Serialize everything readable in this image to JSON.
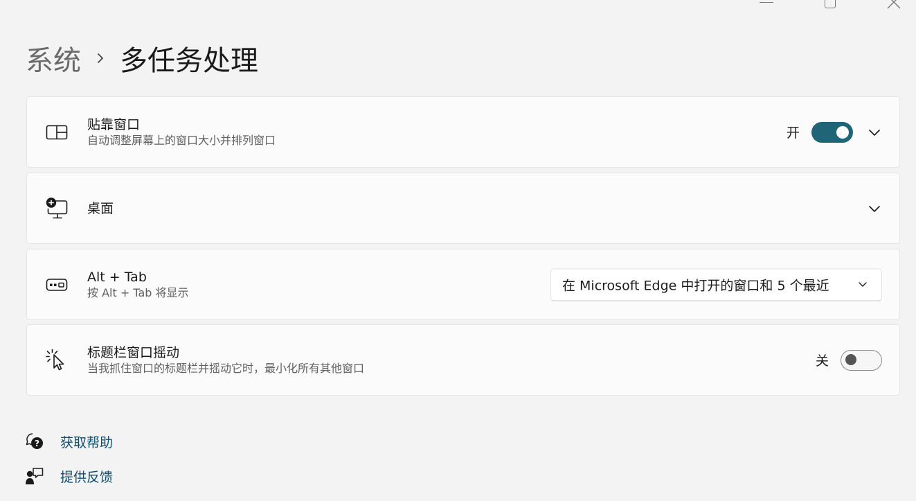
{
  "breadcrumb": {
    "parent": "系统",
    "current": "多任务处理"
  },
  "snap_windows": {
    "title": "贴靠窗口",
    "subtitle": "自动调整屏幕上的窗口大小并排列窗口",
    "toggle_label": "开",
    "toggle_on": true,
    "icon": "snap-layout-icon"
  },
  "desktops": {
    "title": "桌面",
    "icon": "desktop-add-icon"
  },
  "alt_tab": {
    "title": "Alt + Tab",
    "subtitle": "按 Alt + Tab 将显示",
    "dropdown_value": "在 Microsoft Edge 中打开的窗口和 5 个最近",
    "icon": "keyboard-icon"
  },
  "title_bar_shake": {
    "title": "标题栏窗口摇动",
    "subtitle": "当我抓住窗口的标题栏并摇动它时，最小化所有其他窗口",
    "toggle_label": "关",
    "toggle_on": false,
    "icon": "shake-cursor-icon"
  },
  "footer": {
    "help_label": "获取帮助",
    "feedback_label": "提供反馈"
  },
  "colors": {
    "accent": "#1f6577",
    "link": "#0f4c6e",
    "background": "#f3f3f3",
    "card": "#fbfbfb"
  }
}
